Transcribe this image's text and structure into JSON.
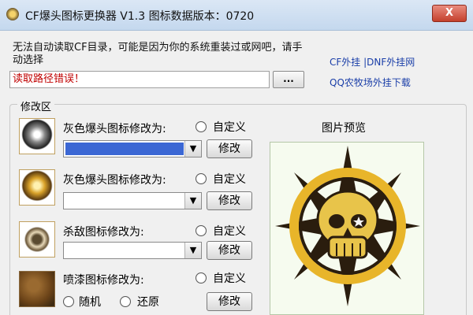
{
  "window": {
    "title": "CF爆头图标更换器 V1.3   图标数据版本：0720",
    "close_label": "X"
  },
  "notice": {
    "text": "无法自动读取CF目录，可能是因为你的系统重装过或网吧，请手动选择"
  },
  "links": {
    "cf_dnf": "CF外挂 |DNF外挂网",
    "qq_farm": "QQ农牧场外挂下载"
  },
  "path": {
    "value": "读取路径错误！",
    "browse_label": "..."
  },
  "group": {
    "label": "修改区"
  },
  "rows": [
    {
      "label": "灰色爆头图标修改为:",
      "custom_label": "自定义",
      "button_label": "修改",
      "icon": "grey-headshot-skull-icon"
    },
    {
      "label": "灰色爆头图标修改为:",
      "custom_label": "自定义",
      "button_label": "修改",
      "icon": "gold-headshot-skull-icon"
    },
    {
      "label": "杀敌图标修改为:",
      "custom_label": "自定义",
      "button_label": "修改",
      "icon": "kill-icon"
    },
    {
      "label": "喷漆图标修改为:",
      "custom_label": "自定义",
      "button_label": "修改",
      "icon": "spray-icon",
      "options": [
        "随机",
        "还原"
      ]
    }
  ],
  "preview": {
    "title": "图片预览",
    "image": "golden-skull-star-icon",
    "colors": {
      "gold": "#e8b52a",
      "dark": "#2a1d0e",
      "bg": "#f6fbef"
    }
  }
}
